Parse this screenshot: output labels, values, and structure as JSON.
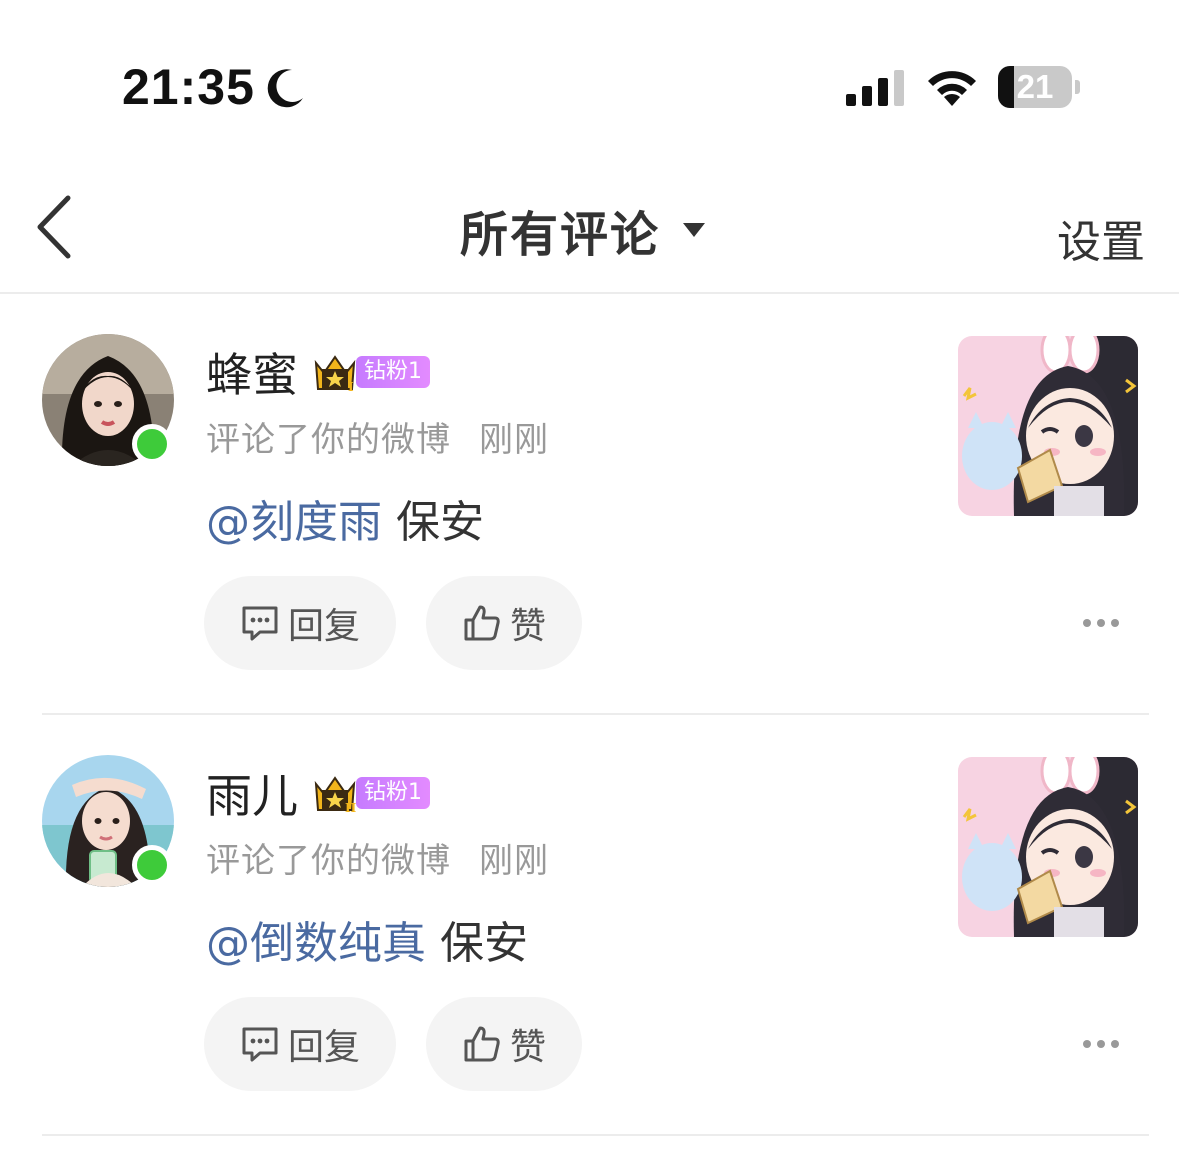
{
  "status_bar": {
    "time": "21:35",
    "battery_level": "21",
    "battery_fraction": 0.21
  },
  "nav": {
    "title": "所有评论",
    "settings_label": "设置"
  },
  "comments": [
    {
      "username": "蜂蜜",
      "fan_badge": "钻粉1",
      "action": "评论了你的微博",
      "time_ago": "刚刚",
      "mention": "@刻度雨",
      "text": "保安",
      "reply_label": "回复",
      "like_label": "赞",
      "crown_level": "I"
    },
    {
      "username": "雨儿",
      "fan_badge": "钻粉1",
      "action": "评论了你的微博",
      "time_ago": "刚刚",
      "mention": "@倒数纯真",
      "text": "保安",
      "reply_label": "回复",
      "like_label": "赞",
      "crown_level": "II"
    }
  ],
  "colors": {
    "mention": "#4a6aa1",
    "online": "#3ecb3a",
    "fan_badge": "#d083ff",
    "button_bg": "#f4f4f4"
  }
}
